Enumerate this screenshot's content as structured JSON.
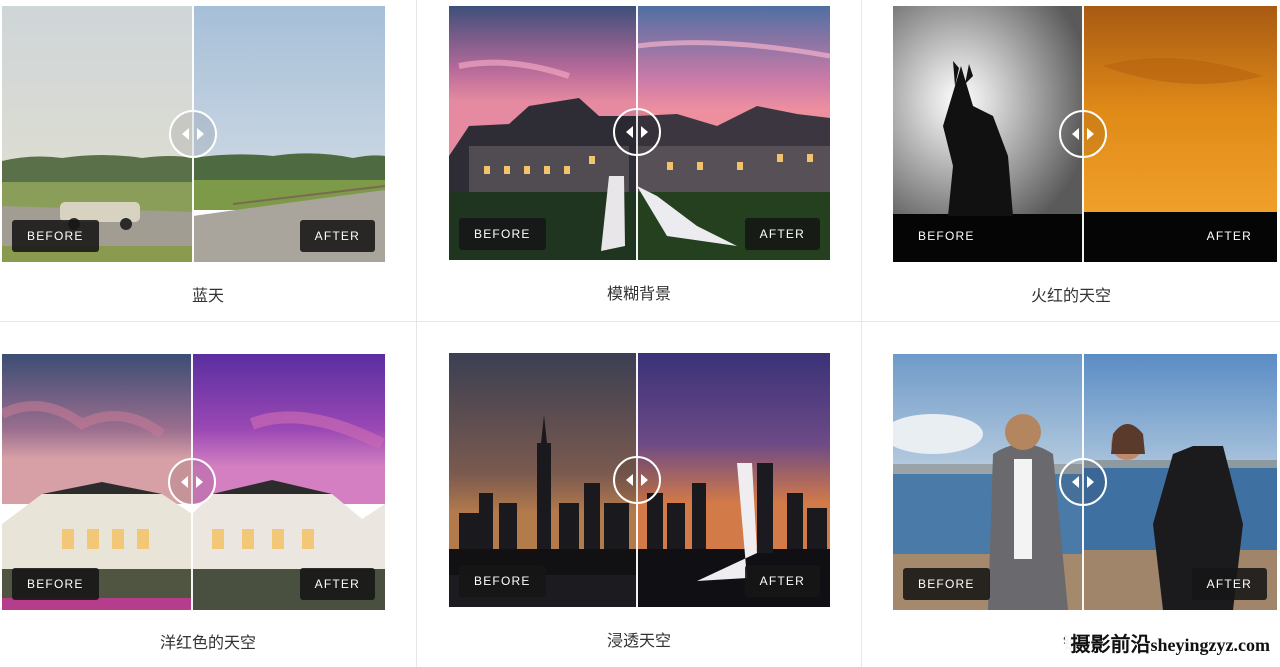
{
  "compare_labels": {
    "before": "BEFORE",
    "after": "AFTER"
  },
  "cards": [
    {
      "caption": "蓝天",
      "handle_icon": "split-arrows-icon"
    },
    {
      "caption": "模糊背景",
      "handle_icon": "split-arrows-icon"
    },
    {
      "caption": "火红的天空",
      "handle_icon": "split-arrows-icon"
    },
    {
      "caption": "洋红色的天空",
      "handle_icon": "split-arrows-icon"
    },
    {
      "caption": "浸透天空",
      "handle_icon": "split-arrows-icon"
    },
    {
      "caption": "锐",
      "handle_icon": "split-arrows-icon"
    }
  ],
  "watermark": {
    "cn": "摄影前沿",
    "latin": "sheyingzyz.com"
  },
  "colors": {
    "tag_bg": "#161616",
    "divider": "#ffffff",
    "caption_text": "#333333"
  }
}
